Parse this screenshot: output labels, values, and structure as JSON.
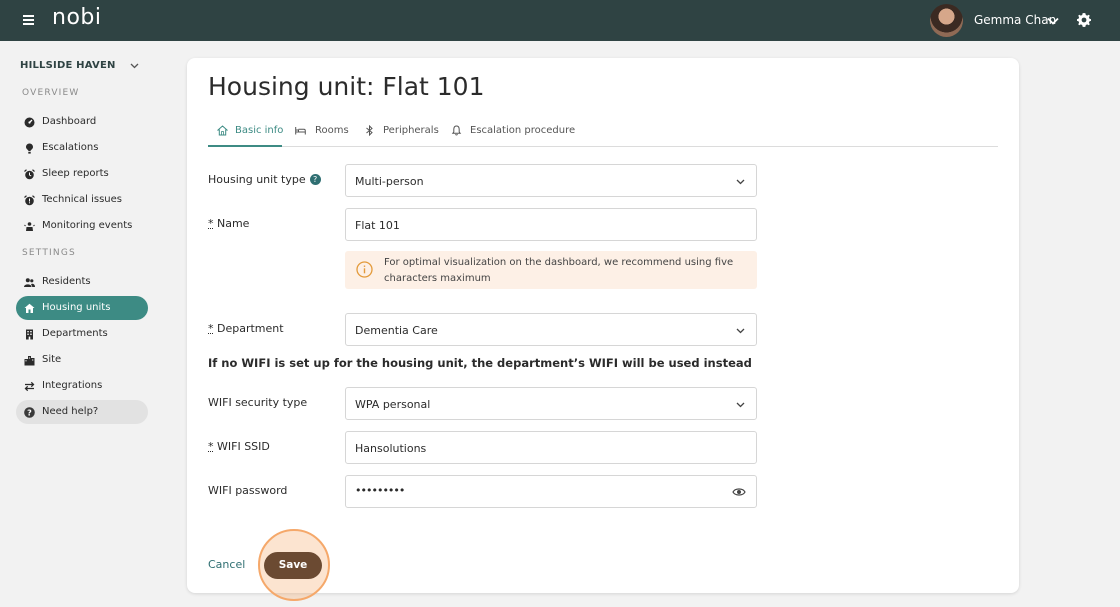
{
  "topbar": {
    "logo": "nobi",
    "user_name": "Gemma Chan"
  },
  "sidebar": {
    "site_name": "HILLSIDE HAVEN",
    "overview_title": "OVERVIEW",
    "settings_title": "SETTINGS",
    "overview_items": [
      {
        "label": "Dashboard",
        "icon": "dashboard-icon"
      },
      {
        "label": "Escalations",
        "icon": "escalation-icon"
      },
      {
        "label": "Sleep reports",
        "icon": "alarm-clock-icon"
      },
      {
        "label": "Technical issues",
        "icon": "technical-icon"
      },
      {
        "label": "Monitoring events",
        "icon": "monitoring-icon"
      }
    ],
    "settings_items": [
      {
        "label": "Residents",
        "icon": "people-icon"
      },
      {
        "label": "Housing units",
        "icon": "home-icon",
        "active": true
      },
      {
        "label": "Departments",
        "icon": "building-icon"
      },
      {
        "label": "Site",
        "icon": "city-icon"
      },
      {
        "label": "Integrations",
        "icon": "swap-arrows-icon"
      }
    ],
    "help_label": "Need help?"
  },
  "page": {
    "title": "Housing unit: Flat 101",
    "tabs": [
      {
        "label": "Basic info",
        "icon": "home-icon",
        "active": true
      },
      {
        "label": "Rooms",
        "icon": "bed-icon"
      },
      {
        "label": "Peripherals",
        "icon": "bluetooth-icon"
      },
      {
        "label": "Escalation procedure",
        "icon": "bell-icon"
      }
    ]
  },
  "form": {
    "required_marker": "*",
    "housing_unit_type": {
      "label": "Housing unit type",
      "value": "Multi-person"
    },
    "name": {
      "label": "Name",
      "value": "Flat 101"
    },
    "name_warning": "For optimal visualization on the dashboard, we recommend using five characters maximum",
    "department": {
      "label": "Department",
      "value": "Dementia Care"
    },
    "wifi_note": "If no WIFI is set up for the housing unit, the department’s WIFI will be used instead",
    "wifi_security_type": {
      "label": "WIFI security type",
      "value": "WPA personal"
    },
    "wifi_ssid": {
      "label": "WIFI SSID",
      "value": "Hansolutions"
    },
    "wifi_password": {
      "label": "WIFI password",
      "value": "•••••••••"
    },
    "cancel_label": "Cancel",
    "save_label": "Save"
  },
  "colors": {
    "topbar": "#2f4343",
    "accent": "#3d8b84",
    "save_button": "#6b4a32",
    "warning_bg": "#fdf0e6",
    "highlight": "#f5a86a"
  }
}
